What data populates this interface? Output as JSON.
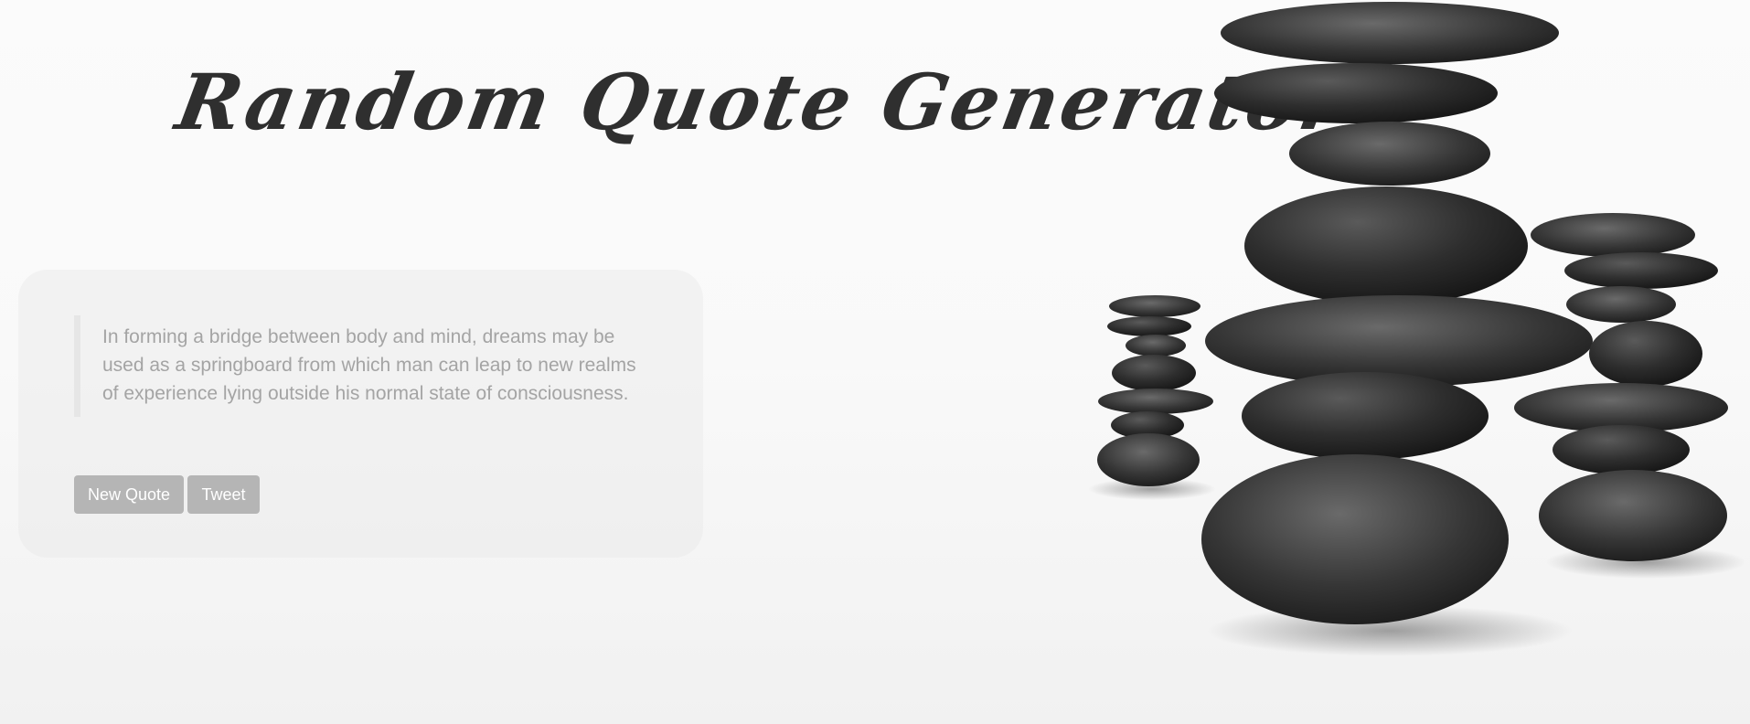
{
  "header": {
    "title": "Random Quote Generator"
  },
  "quote": {
    "text": "In forming a bridge between body and mind, dreams may be used as a springboard from which man can leap to new realms of experience lying outside his normal state of consciousness."
  },
  "buttons": {
    "new_quote_label": "New Quote",
    "tweet_label": "Tweet"
  },
  "colors": {
    "title": "#2f2f2f",
    "quote_text": "#a4a4a4",
    "button_bg": "#b5b5b5",
    "button_text": "#ffffff",
    "stones": "#2a2a2a"
  },
  "background": {
    "image": "stacked-zen-stones-icon"
  }
}
